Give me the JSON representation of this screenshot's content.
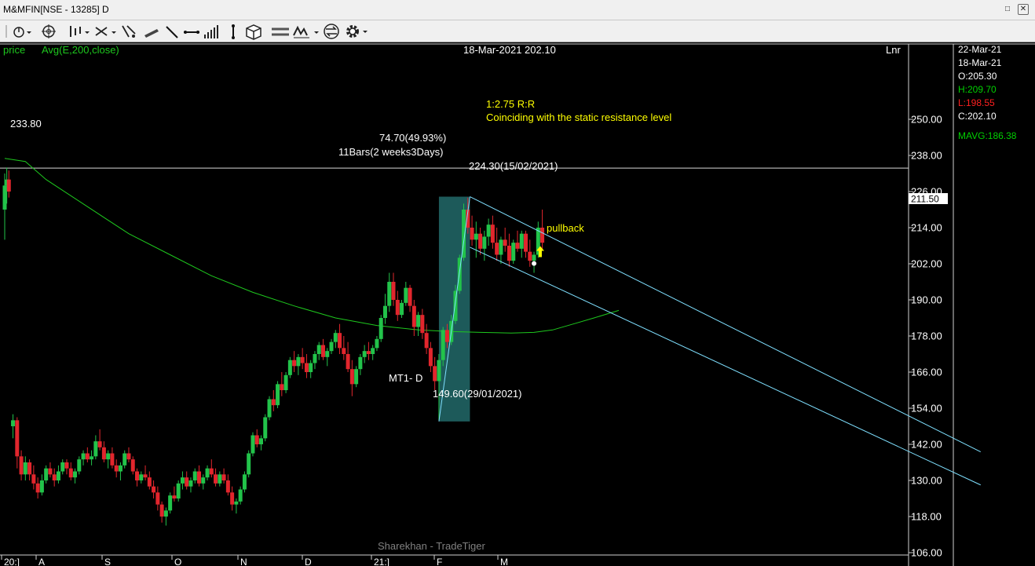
{
  "window": {
    "title": "M&MFIN[NSE - 13285] D"
  },
  "toolbar": {
    "icons": [
      "cursor-icon",
      "crosshair-icon",
      "bar-type-icon",
      "draw-tools-icon",
      "fib-icon",
      "pen-icon",
      "line-icon",
      "hline-icon",
      "volume-icon",
      "vline-icon",
      "package-icon",
      "indicators-icon",
      "studies-icon",
      "compare-icon",
      "settings-icon"
    ]
  },
  "header": {
    "price_label": "price",
    "indicator_label": "Avg(E,200,close)",
    "cursor_readout": "18-Mar-2021 202.10",
    "scale_label": "Lnr"
  },
  "side_panel": {
    "date1": "22-Mar-21",
    "date2": "18-Mar-21",
    "open": "O:205.30",
    "high": "H:209.70",
    "low": "L:198.55",
    "close": "C:202.10",
    "mavg": "MAVG:186.38"
  },
  "colors": {
    "bull": "#22c34a",
    "bear": "#e2262d",
    "ma": "#1ec81e",
    "channel": "#7fe0ff",
    "box": "#1d5a5a",
    "annotation": "#ffff00",
    "side_high": "#00d000",
    "side_low": "#ff2020"
  },
  "annotations": {
    "rr": "1:2.75 R:R",
    "resistance_text": "Coinciding with the static resistance level",
    "resistance_value": "233.80",
    "move_label": "74.70(49.93%)",
    "bars_label": "11Bars(2 weeks3Days)",
    "top_label": "224.30(15/02/2021)",
    "bottom_label": "149.60(29/01/2021)",
    "mt1_label": "MT1- D",
    "pullback": "pullback",
    "watermark": "Sharekhan - TradeTiger",
    "current_price": "211.50"
  },
  "chart_data": {
    "type": "candlestick",
    "y_ticks": [
      "250.00",
      "238.00",
      "226.00",
      "214.00",
      "202.00",
      "190.00",
      "178.00",
      "166.00",
      "154.00",
      "142.00",
      "130.00",
      "118.00",
      "106.00"
    ],
    "ylim": [
      94,
      259
    ],
    "x_ticks": [
      "20:]",
      "A",
      "S",
      "O",
      "N",
      "D",
      "21:]",
      "F",
      "M"
    ],
    "resistance": 233.8,
    "ma_points": [
      [
        0,
        237
      ],
      [
        10,
        236
      ],
      [
        20,
        230
      ],
      [
        40,
        221
      ],
      [
        60,
        212
      ],
      [
        80,
        205
      ],
      [
        100,
        198
      ],
      [
        120,
        192.5
      ],
      [
        140,
        188
      ],
      [
        160,
        184
      ],
      [
        180,
        181.5
      ],
      [
        200,
        180
      ],
      [
        215,
        179.5
      ],
      [
        230,
        179.2
      ],
      [
        245,
        179
      ],
      [
        256,
        179.2
      ],
      [
        265,
        180
      ],
      [
        275,
        182
      ],
      [
        285,
        184
      ],
      [
        297,
        186.5
      ]
    ],
    "candles": [
      [
        0,
        220,
        232,
        210,
        228
      ],
      [
        1,
        228,
        234,
        222,
        230
      ],
      [
        2,
        230,
        233,
        224,
        226
      ],
      [
        4,
        148,
        152,
        144,
        150
      ],
      [
        6,
        150,
        151,
        134,
        138
      ],
      [
        8,
        138,
        140,
        130,
        132
      ],
      [
        10,
        132,
        138,
        130,
        136
      ],
      [
        12,
        136,
        137,
        130,
        132
      ],
      [
        14,
        132,
        135,
        127,
        129
      ],
      [
        16,
        129,
        131,
        124,
        126
      ],
      [
        18,
        126,
        132,
        125,
        130
      ],
      [
        20,
        130,
        135,
        129,
        134
      ],
      [
        22,
        134,
        136,
        131,
        132
      ],
      [
        24,
        132,
        134,
        128,
        130
      ],
      [
        26,
        130,
        135,
        129,
        133
      ],
      [
        28,
        133,
        137,
        132,
        136
      ],
      [
        30,
        136,
        137,
        132,
        134
      ],
      [
        32,
        134,
        136,
        130,
        131
      ],
      [
        34,
        131,
        134,
        129,
        133
      ],
      [
        36,
        133,
        138,
        132,
        137
      ],
      [
        38,
        137,
        140,
        135,
        139
      ],
      [
        40,
        139,
        141,
        136,
        137
      ],
      [
        42,
        137,
        140,
        135,
        138
      ],
      [
        44,
        138,
        145,
        137,
        143
      ],
      [
        46,
        143,
        147,
        140,
        141
      ],
      [
        48,
        141,
        143,
        136,
        137
      ],
      [
        50,
        137,
        140,
        134,
        139
      ],
      [
        52,
        139,
        141,
        134,
        135
      ],
      [
        54,
        135,
        137,
        131,
        133
      ],
      [
        56,
        133,
        136,
        130,
        135
      ],
      [
        58,
        135,
        140,
        134,
        139
      ],
      [
        60,
        139,
        141,
        136,
        137
      ],
      [
        62,
        137,
        138,
        132,
        133
      ],
      [
        64,
        133,
        134,
        128,
        130
      ],
      [
        66,
        130,
        133,
        129,
        132
      ],
      [
        68,
        132,
        135,
        130,
        131
      ],
      [
        70,
        131,
        133,
        127,
        128
      ],
      [
        72,
        128,
        130,
        124,
        126
      ],
      [
        74,
        126,
        128,
        120,
        122
      ],
      [
        76,
        122,
        123,
        116,
        118
      ],
      [
        78,
        118,
        121,
        115,
        120
      ],
      [
        80,
        120,
        126,
        119,
        125
      ],
      [
        82,
        125,
        128,
        123,
        124
      ],
      [
        84,
        124,
        130,
        123,
        129
      ],
      [
        86,
        129,
        133,
        127,
        131
      ],
      [
        88,
        131,
        133,
        127,
        128
      ],
      [
        90,
        128,
        131,
        126,
        130
      ],
      [
        92,
        130,
        134,
        129,
        133
      ],
      [
        94,
        133,
        135,
        128,
        129
      ],
      [
        96,
        129,
        132,
        127,
        131
      ],
      [
        98,
        131,
        135,
        130,
        134
      ],
      [
        100,
        134,
        137,
        131,
        132
      ],
      [
        102,
        132,
        134,
        128,
        129
      ],
      [
        104,
        129,
        133,
        128,
        132
      ],
      [
        106,
        132,
        134,
        129,
        130
      ],
      [
        108,
        130,
        132,
        125,
        126
      ],
      [
        110,
        126,
        128,
        120,
        122
      ],
      [
        112,
        122,
        124,
        119,
        123
      ],
      [
        114,
        123,
        128,
        122,
        127
      ],
      [
        116,
        127,
        133,
        126,
        132
      ],
      [
        118,
        132,
        140,
        131,
        139
      ],
      [
        120,
        139,
        146,
        138,
        145
      ],
      [
        122,
        145,
        147,
        141,
        142
      ],
      [
        124,
        142,
        145,
        140,
        144
      ],
      [
        126,
        144,
        152,
        143,
        151
      ],
      [
        128,
        151,
        158,
        150,
        157
      ],
      [
        130,
        157,
        160,
        153,
        155
      ],
      [
        132,
        155,
        163,
        154,
        162
      ],
      [
        134,
        162,
        166,
        158,
        160
      ],
      [
        136,
        160,
        166,
        159,
        165
      ],
      [
        138,
        165,
        171,
        164,
        170
      ],
      [
        140,
        170,
        173,
        166,
        168
      ],
      [
        142,
        168,
        172,
        165,
        171
      ],
      [
        144,
        171,
        174,
        167,
        169
      ],
      [
        146,
        169,
        172,
        164,
        166
      ],
      [
        148,
        166,
        170,
        164,
        169
      ],
      [
        150,
        169,
        173,
        167,
        172
      ],
      [
        152,
        172,
        176,
        170,
        175
      ],
      [
        154,
        175,
        177,
        170,
        171
      ],
      [
        156,
        171,
        174,
        168,
        173
      ],
      [
        158,
        173,
        177,
        172,
        176
      ],
      [
        160,
        176,
        180,
        174,
        179
      ],
      [
        162,
        179,
        182,
        172,
        174
      ],
      [
        164,
        174,
        178,
        170,
        172
      ],
      [
        166,
        172,
        176,
        166,
        167
      ],
      [
        168,
        167,
        170,
        158,
        162
      ],
      [
        170,
        162,
        168,
        161,
        167
      ],
      [
        172,
        167,
        172,
        165,
        171
      ],
      [
        174,
        171,
        175,
        169,
        173
      ],
      [
        176,
        173,
        176,
        170,
        172
      ],
      [
        178,
        172,
        175,
        170,
        174
      ],
      [
        180,
        174,
        178,
        173,
        177
      ],
      [
        182,
        177,
        185,
        176,
        184
      ],
      [
        184,
        184,
        192,
        182,
        188
      ],
      [
        186,
        188,
        199,
        186,
        196
      ],
      [
        188,
        196,
        199,
        188,
        190
      ],
      [
        190,
        190,
        193,
        183,
        185
      ],
      [
        192,
        185,
        190,
        184,
        189
      ],
      [
        194,
        189,
        196,
        188,
        194
      ],
      [
        196,
        194,
        195,
        186,
        188
      ],
      [
        198,
        188,
        190,
        178,
        181
      ],
      [
        200,
        181,
        186,
        178,
        185
      ],
      [
        202,
        185,
        187,
        177,
        179
      ],
      [
        204,
        179,
        182,
        172,
        174
      ],
      [
        206,
        174,
        176,
        166,
        168
      ],
      [
        208,
        168,
        171,
        160,
        163
      ],
      [
        210,
        163,
        172,
        150,
        170
      ],
      [
        212,
        170,
        181,
        168,
        180
      ],
      [
        214,
        180,
        182,
        174,
        176
      ],
      [
        216,
        176,
        185,
        175,
        183
      ],
      [
        218,
        183,
        195,
        182,
        193
      ],
      [
        220,
        193,
        205,
        192,
        204
      ],
      [
        222,
        204,
        222,
        203,
        220
      ],
      [
        224,
        220,
        224,
        212,
        214
      ],
      [
        226,
        214,
        218,
        208,
        210
      ],
      [
        228,
        210,
        216,
        204,
        212
      ],
      [
        230,
        212,
        214,
        205,
        207
      ],
      [
        232,
        207,
        213,
        203,
        211
      ],
      [
        234,
        211,
        217,
        208,
        215
      ],
      [
        236,
        215,
        218,
        207,
        209
      ],
      [
        238,
        209,
        214,
        203,
        205
      ],
      [
        240,
        205,
        211,
        202,
        210
      ],
      [
        242,
        210,
        214,
        206,
        208
      ],
      [
        244,
        208,
        212,
        201,
        203
      ],
      [
        246,
        203,
        210,
        202,
        209
      ],
      [
        248,
        209,
        213,
        206,
        207
      ],
      [
        250,
        207,
        213,
        204,
        212
      ],
      [
        252,
        212,
        213,
        204,
        206
      ],
      [
        254,
        206,
        210,
        201,
        203
      ],
      [
        256,
        203,
        206,
        199,
        205
      ],
      [
        258,
        205,
        216,
        204,
        214
      ],
      [
        260,
        214,
        220,
        207,
        209
      ]
    ],
    "fib_box": {
      "x_from": 210,
      "x_to": 225,
      "low": 149.6,
      "high": 224.3
    },
    "channel_upper": [
      [
        225,
        224.3
      ],
      [
        472,
        139.5
      ]
    ],
    "channel_lower": [
      [
        225,
        207.5
      ],
      [
        472,
        128.5
      ]
    ]
  }
}
